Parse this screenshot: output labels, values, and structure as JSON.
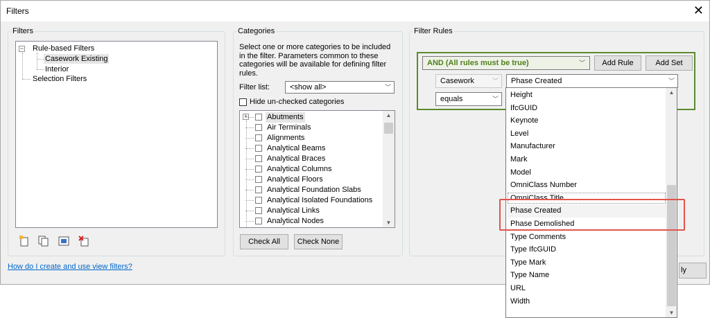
{
  "window": {
    "title": "Filters",
    "close_glyph": "✕"
  },
  "filters_group": {
    "legend": "Filters",
    "tree": {
      "root": "Rule-based Filters",
      "children": [
        "Casework Existing",
        "Interior"
      ],
      "selection_filters": "Selection Filters"
    },
    "toolbar_icons": [
      "new-filter-icon",
      "duplicate-filter-icon",
      "rename-filter-icon",
      "delete-filter-icon"
    ],
    "help_link": "How do I create and use view filters?"
  },
  "categories_group": {
    "legend": "Categories",
    "description": "Select one or more categories to be included in the filter.  Parameters common to these categories will be available for defining filter rules.",
    "filter_list_label": "Filter list:",
    "filter_list_value": "<show all>",
    "hide_unchecked_label": "Hide un-checked categories",
    "items": [
      "Abutments",
      "Air Terminals",
      "Alignments",
      "Analytical Beams",
      "Analytical Braces",
      "Analytical Columns",
      "Analytical Floors",
      "Analytical Foundation Slabs",
      "Analytical Isolated Foundations",
      "Analytical Links",
      "Analytical Nodes"
    ],
    "check_all": "Check All",
    "check_none": "Check None"
  },
  "filter_rules_group": {
    "legend": "Filter Rules",
    "and_combo": "AND (All rules must be true)",
    "add_rule": "Add Rule",
    "add_set": "Add Set",
    "category_value": "Casework",
    "parameter_value": "Phase Created",
    "operator_value": "equals",
    "dropdown_items": [
      "Height",
      "IfcGUID",
      "Keynote",
      "Level",
      "Manufacturer",
      "Mark",
      "Model",
      "OmniClass Number",
      "OmniClass Title",
      "Phase Created",
      "Phase Demolished",
      "Type Comments",
      "Type IfcGUID",
      "Type Mark",
      "Type Name",
      "URL",
      "Width"
    ],
    "apply_partial": "ly"
  },
  "colors": {
    "accent_green": "#5c8a2e",
    "highlight_red": "#e0544c",
    "link_blue": "#0066cc"
  }
}
